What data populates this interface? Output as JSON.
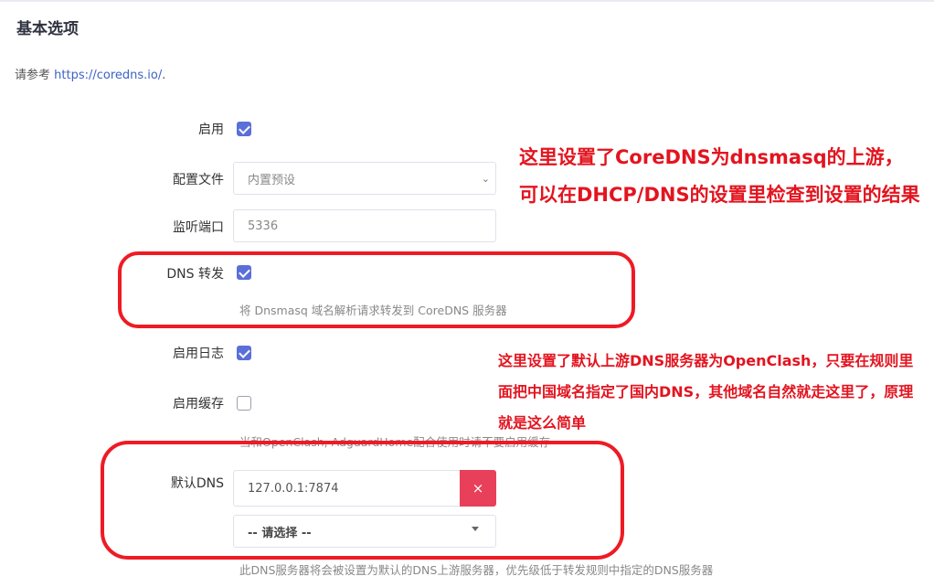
{
  "section": {
    "title": "基本选项",
    "reference_prefix": "请参考 ",
    "reference_link": "https://coredns.io/",
    "reference_suffix": "."
  },
  "form": {
    "enable": {
      "label": "启用",
      "checked": true
    },
    "config_file": {
      "label": "配置文件",
      "value": "内置预设"
    },
    "listen_port": {
      "label": "监听端口",
      "placeholder": "5336"
    },
    "dns_forward": {
      "label": "DNS 转发",
      "checked": true,
      "hint": "将 Dnsmasq 域名解析请求转发到 CoreDNS 服务器"
    },
    "enable_log": {
      "label": "启用日志",
      "checked": true
    },
    "enable_cache": {
      "label": "启用缓存",
      "checked": false,
      "hint": "当和OpenClash, AdguardHome配合使用时请不要启用缓存"
    },
    "default_dns": {
      "label": "默认DNS",
      "value": "127.0.0.1:7874",
      "delete_label": "×",
      "select_placeholder": "-- 请选择 --",
      "hint": "此DNS服务器将会被设置为默认的DNS上游服务器，优先级低于转发规则中指定的DNS服务器"
    }
  },
  "annotations": {
    "note1": "这里设置了CoreDNS为dnsmasq的上游，可以在DHCP/DNS的设置里检查到设置的结果",
    "note2": "这里设置了默认上游DNS服务器为OpenClash，只要在规则里面把中国域名指定了国内DNS，其他域名自然就走这里了，原理就是这么简单"
  },
  "colors": {
    "accent": "#5b6fd8",
    "danger": "#e8405a",
    "annotation": "#ee1b24",
    "link": "#3b63c4"
  }
}
